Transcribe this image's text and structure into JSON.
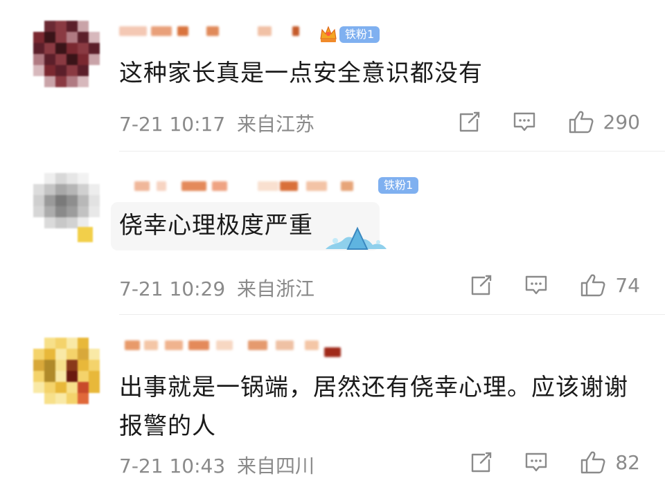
{
  "comments": [
    {
      "badge": "铁粉1",
      "text": "这种家长真是一点安全意识都没有",
      "time": "7-21 10:17",
      "location": "来自江苏",
      "likes": "290",
      "avatar_colors": [
        "#5b1f2a",
        "#8a3a42",
        "#b07a82",
        "#3a1418",
        "#c9a3a8",
        "#7a2830"
      ]
    },
    {
      "badge": "铁粉1",
      "text": "侥幸心理极度严重",
      "time": "7-21 10:29",
      "location": "来自浙江",
      "likes": "74",
      "avatar_colors": [
        "#d8d8d8",
        "#a8a8a8",
        "#7a7a7a",
        "#c4c4c4",
        "#efefef",
        "#f2cf4a"
      ]
    },
    {
      "badge": "",
      "text": "出事就是一锅端，居然还有侥幸心理。应该谢谢报警的人",
      "time": "7-21 10:43",
      "location": "来自四川",
      "likes": "82",
      "avatar_colors": [
        "#f4d36b",
        "#e8b83a",
        "#8a3a1a",
        "#f9e9a6",
        "#c84a2a",
        "#b08a2a"
      ]
    }
  ],
  "icons": {
    "share": "share-icon",
    "reply": "comment-icon",
    "like": "thumbs-up-icon"
  },
  "colors": {
    "badge": "#7fb0f0",
    "text": "#1a1a1a",
    "meta": "#8a8a8a"
  }
}
